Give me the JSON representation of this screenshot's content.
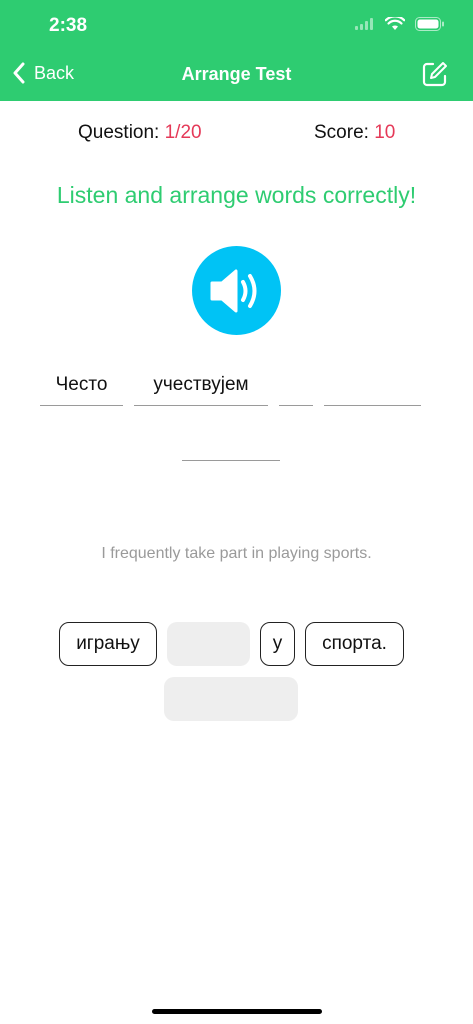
{
  "status": {
    "time": "2:38"
  },
  "nav": {
    "back_label": "Back",
    "title": "Arrange Test"
  },
  "stats": {
    "question_label": "Question:",
    "question_value": "1/20",
    "score_label": "Score:",
    "score_value": "10"
  },
  "instruction": "Listen and arrange words correctly!",
  "answer_slots": [
    "Често",
    "учествујем",
    "",
    "",
    ""
  ],
  "translation": "I frequently take part in playing sports.",
  "word_chips": [
    "игрању",
    "",
    "у",
    "спорта.",
    ""
  ],
  "colors": {
    "header": "#2ecc71",
    "accent_red": "#e53958",
    "sound_button": "#00c3f5",
    "translation_text": "#9a9a9a"
  },
  "icons": [
    "back-chevron-icon",
    "edit-icon",
    "speaker-icon",
    "wifi-icon",
    "battery-icon",
    "signal-icon"
  ]
}
